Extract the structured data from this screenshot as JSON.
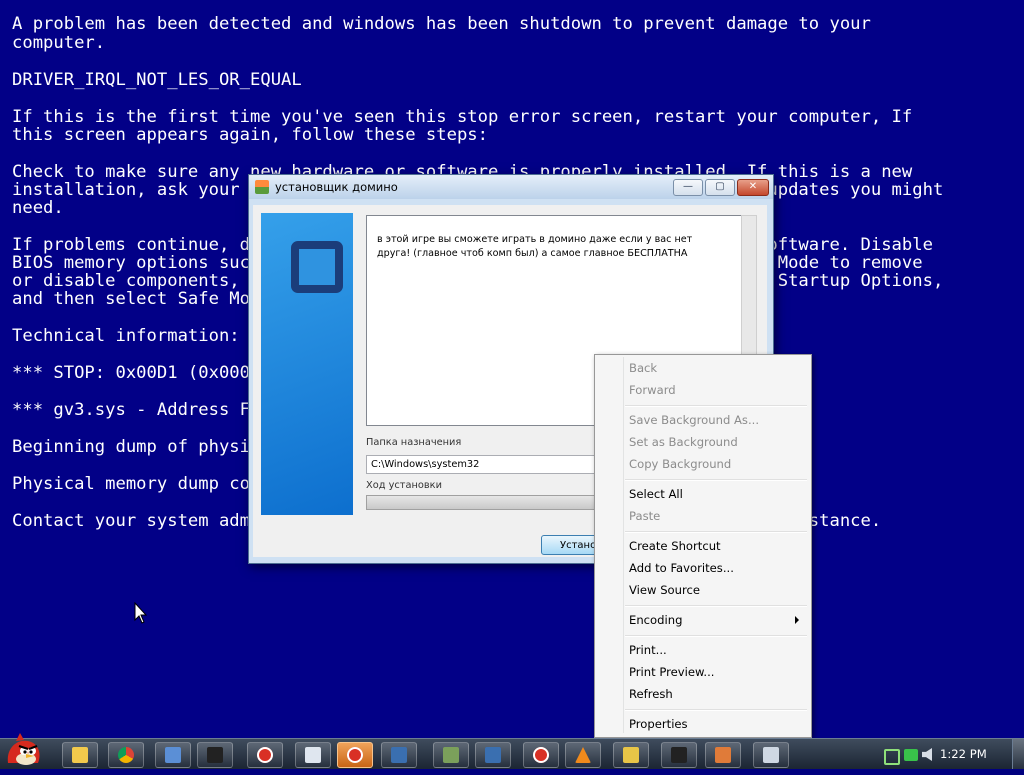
{
  "bsod": {
    "lines": [
      "A problem has been detected and windows has been shutdown to prevent damage to your",
      "computer.",
      "DRIVER_IRQL_NOT_LES_OR_EQUAL",
      "If this is the first time you've seen this stop error screen, restart your computer, If",
      "this screen appears again, follow these steps:",
      "Check to make sure any new hardware or software is properly installed. If this is a new",
      "installation, ask your hardware or software manufacturer for any windows updates you might",
      "need.",
      "If problems continue, disable or remove any newly installed hardware or software. Disable",
      "BIOS memory options such as caching or shadowing. If you need to use Safe Mode to remove",
      "or disable components, restart your computer, press F8 to select Advanced Startup Options,",
      "and then select Safe Mode.",
      "Technical information:",
      "*** STOP: 0x00D1 (0x0000000C,0x00000002,0x00000000,0xF86B5A89)",
      "*** gv3.sys - Address F86B5A89 base at F86B5000, DateStamp 3dd991eb",
      "Beginning dump of physical memory",
      "Physical memory dump complete.",
      "Contact your system administrator or technical support group for further assistance."
    ]
  },
  "installer": {
    "title": "установщик домино",
    "description": "в этой игре вы сможете играть в домино даже если у вас нет друга! (главное чтоб комп был) а самое главное БЕСПЛАТНА",
    "destination_label": "Папка назначения",
    "destination_value": "C:\\Windows\\system32",
    "progress_label": "Ход установки",
    "progress_fraction": 0,
    "install_button": "Установить",
    "minimize_glyph": "—",
    "maximize_glyph": "▢",
    "close_glyph": "✕"
  },
  "context_menu": {
    "items": [
      {
        "label": "Back",
        "enabled": false
      },
      {
        "label": "Forward",
        "enabled": false
      },
      {
        "label": "Save Background As...",
        "enabled": false
      },
      {
        "label": "Set as Background",
        "enabled": false
      },
      {
        "label": "Copy Background",
        "enabled": false
      },
      {
        "label": "Select All",
        "enabled": true
      },
      {
        "label": "Paste",
        "enabled": false
      },
      {
        "label": "Create Shortcut",
        "enabled": true
      },
      {
        "label": "Add to Favorites...",
        "enabled": true
      },
      {
        "label": "View Source",
        "enabled": true
      },
      {
        "label": "Encoding",
        "enabled": true,
        "submenu": true
      },
      {
        "label": "Print...",
        "enabled": true
      },
      {
        "label": "Print Preview...",
        "enabled": true
      },
      {
        "label": "Refresh",
        "enabled": true
      },
      {
        "label": "Properties",
        "enabled": true
      }
    ]
  },
  "taskbar": {
    "start_icon": "angry-bird-icon",
    "buttons": [
      {
        "name": "folder-icon",
        "color": "#f2c94c"
      },
      {
        "name": "chrome-icon",
        "color": "#4caf50"
      },
      {
        "name": "network-icon",
        "color": "#5b8fd6"
      },
      {
        "name": "7zip-icon",
        "color": "#222222"
      },
      {
        "name": "error-icon",
        "color": "#d93025"
      },
      {
        "name": "document-icon",
        "color": "#dfe6ef"
      },
      {
        "name": "error-icon",
        "color": "#d93025",
        "active": true
      },
      {
        "name": "installer-icon",
        "color": "#3a6fb0"
      },
      {
        "name": "setup-icon",
        "color": "#7ba05b"
      },
      {
        "name": "installer-icon",
        "color": "#3a6fb0"
      },
      {
        "name": "error-icon",
        "color": "#d93025"
      },
      {
        "name": "vlc-icon",
        "color": "#f08a1c"
      },
      {
        "name": "disk-icon",
        "color": "#e8c547"
      },
      {
        "name": "eye-icon",
        "color": "#222222"
      },
      {
        "name": "domino-installer-icon",
        "color": "#e07b39"
      },
      {
        "name": "window-icon",
        "color": "#cfd8e3"
      }
    ],
    "clock": "1:22 PM",
    "accent_color": "#020087"
  }
}
